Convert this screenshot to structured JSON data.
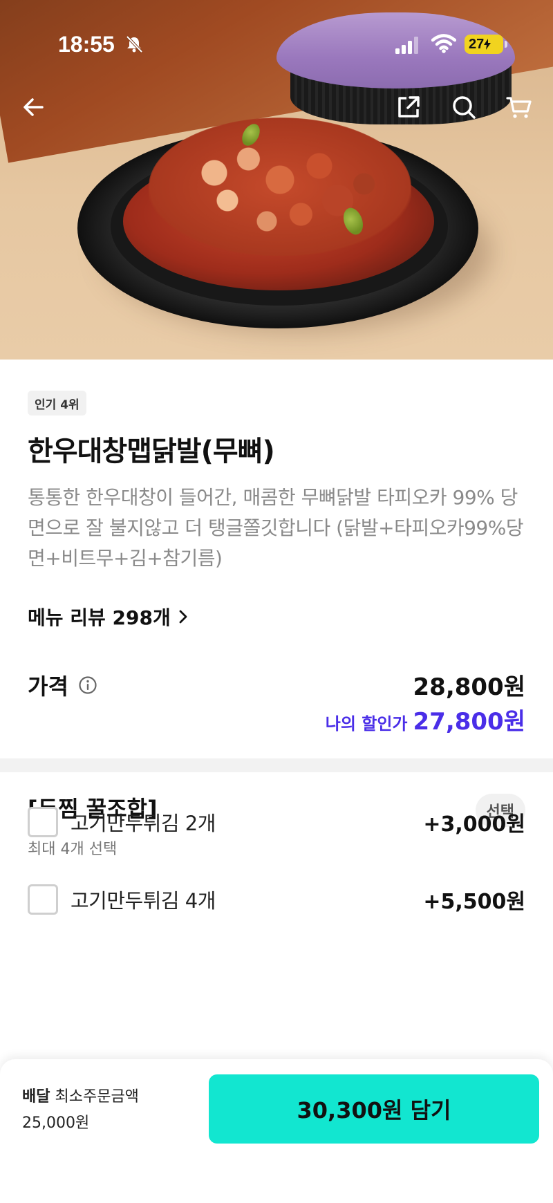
{
  "status_bar": {
    "time": "18:55",
    "battery_level": "27",
    "icons": [
      "bell-off-icon",
      "signal-icon",
      "wifi-icon",
      "battery-icon"
    ]
  },
  "nav": {
    "icons": [
      "back-arrow-icon",
      "share-icon",
      "search-icon",
      "cart-icon"
    ]
  },
  "menu": {
    "rank_badge": "인기 4위",
    "title": "한우대창맵닭발(무뼈)",
    "description": "통통한 한우대창이 들어간, 매콤한 무뼈닭발 타피오카 99% 당면으로 잘 불지않고 더 탱글쫄깃합니다 (닭발+타피오카99%당면+비트무+김+참기름)",
    "review_link": "메뉴 리뷰 298개"
  },
  "price": {
    "label": "가격",
    "value": "28,800원",
    "discount_label": "나의 할인가",
    "discount_value": "27,800원"
  },
  "options": {
    "title": "[두찜 꿀조합]",
    "subtitle": "최대 4개 선택",
    "chip": "선택",
    "items": [
      {
        "label": "고기만두튀김 2개",
        "price": "+3,000원"
      },
      {
        "label": "고기만두튀김 4개",
        "price": "+5,500원"
      }
    ]
  },
  "bottom": {
    "delivery_label": "배달",
    "min_order_label": "최소주문금액",
    "min_order_value": "25,000원",
    "cart_button": "30,300원 담기"
  },
  "colors": {
    "accent_purple": "#4a2ee8",
    "cta_mint": "#12e6d0",
    "battery_yellow": "#f1d31f"
  }
}
